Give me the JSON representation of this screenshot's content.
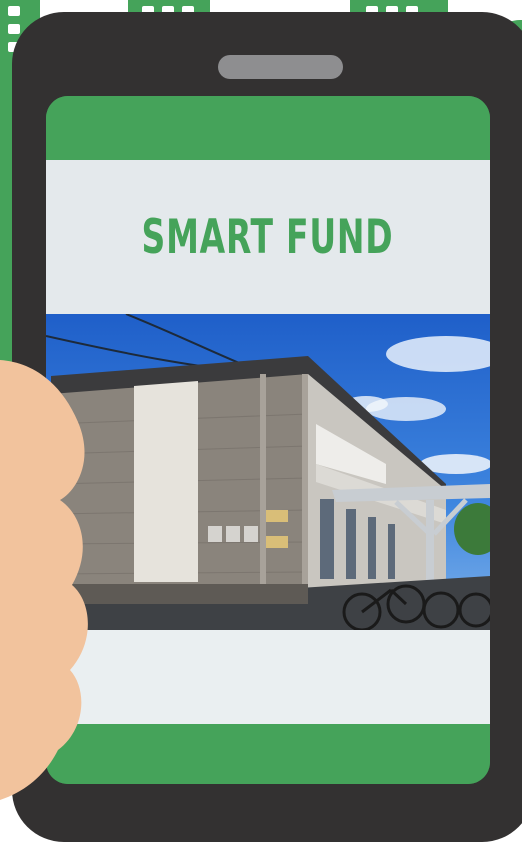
{
  "app": {
    "title": "SMART FUND"
  },
  "screen": {
    "photo_subject": "apartment-building-photo"
  },
  "colors": {
    "accent_green": "#45a35a",
    "phone_body": "#333131",
    "band_light": "#e4e9ec",
    "skin": "#f2c39d"
  }
}
